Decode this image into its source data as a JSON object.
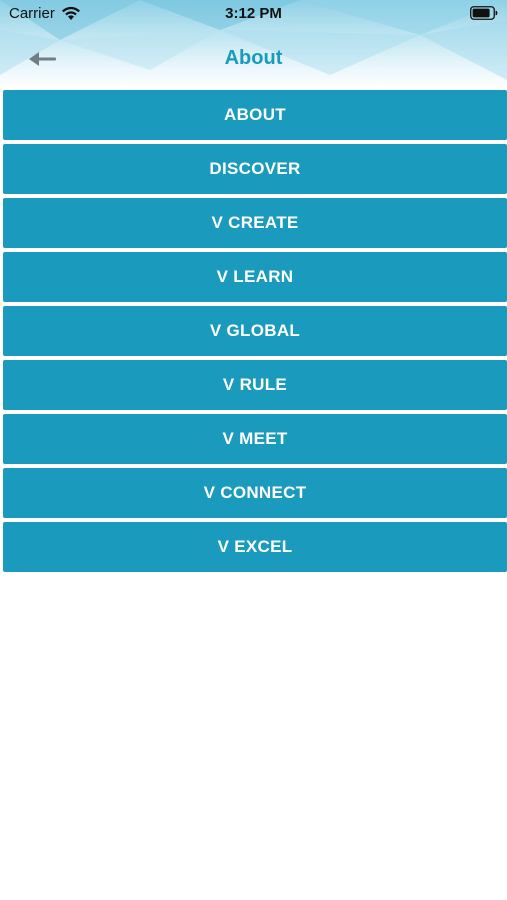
{
  "status_bar": {
    "carrier": "Carrier",
    "time": "3:12 PM"
  },
  "nav": {
    "title": "About",
    "back_icon": "arrow-left-icon"
  },
  "menu": {
    "items": [
      {
        "label": "ABOUT"
      },
      {
        "label": "DISCOVER"
      },
      {
        "label": "V CREATE"
      },
      {
        "label": "V LEARN"
      },
      {
        "label": "V GLOBAL"
      },
      {
        "label": "V RULE"
      },
      {
        "label": "V MEET"
      },
      {
        "label": "V CONNECT"
      },
      {
        "label": "V EXCEL"
      }
    ]
  },
  "colors": {
    "accent": "#1a9bbd",
    "button_text": "#ffffff",
    "background": "#ffffff"
  }
}
